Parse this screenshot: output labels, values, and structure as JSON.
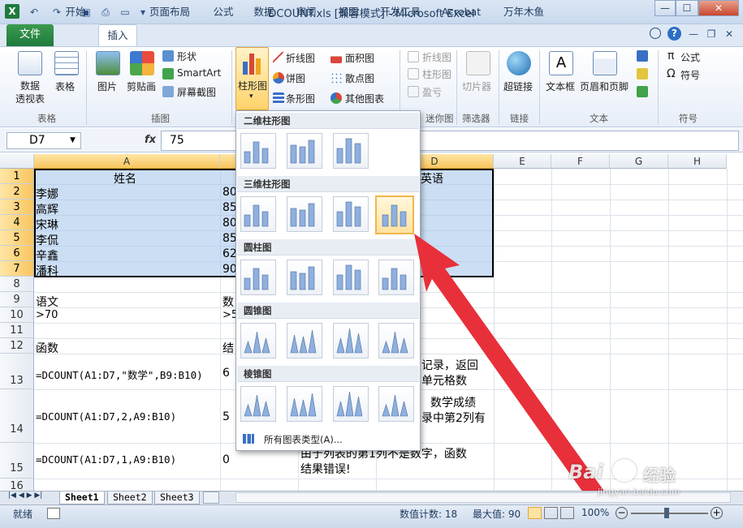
{
  "window": {
    "title": "DCOUNT.xls  [兼容模式] - Microsoft Excel",
    "app_icon": "X"
  },
  "tabs": [
    "文件",
    "开始",
    "插入",
    "页面布局",
    "公式",
    "数据",
    "审阅",
    "视图",
    "开发工具",
    "Acrobat",
    "万年木鱼"
  ],
  "ribbon": {
    "pivot_label": "数据\n透视表",
    "table_label": "表格",
    "picture_label": "图片",
    "clipart_label": "剪贴画",
    "shapes_label": "形状",
    "smartart_label": "SmartArt",
    "screenshot_label": "屏幕截图",
    "column_chart_label": "柱形图",
    "line_chart_label": "折线图",
    "pie_chart_label": "饼图",
    "bar_chart_label": "条形图",
    "area_chart_label": "面积图",
    "scatter_chart_label": "散点图",
    "other_chart_label": "其他图表",
    "spark_line_label": "折线图",
    "spark_column_label": "柱形图",
    "spark_winloss_label": "盈亏",
    "slicer_label": "切片器",
    "hyperlink_label": "超链接",
    "textbox_label": "文本框",
    "headerfooter_label": "页眉和页脚",
    "formula_label": "公式",
    "symbol_label": "符号",
    "groups": {
      "tables": "表格",
      "illustrations": "插图",
      "sparklines": "迷你图",
      "filter": "筛选器",
      "links": "链接",
      "text": "文本",
      "symbols": "符号"
    }
  },
  "formula_bar": {
    "name_box": "D7",
    "fx": "fx",
    "value": "75"
  },
  "columns": [
    "A",
    "B",
    "C",
    "D",
    "E",
    "F",
    "G",
    "H"
  ],
  "rows": [
    "1",
    "2",
    "3",
    "4",
    "5",
    "6",
    "7",
    "8",
    "9",
    "10",
    "11",
    "12",
    "13",
    "14",
    "15",
    "16"
  ],
  "cells": {
    "a1": "姓名",
    "d1": "英语",
    "a2": "李娜",
    "b2": "80",
    "a3": "高辉",
    "b3": "85",
    "a4": "宋琳",
    "b4": "80",
    "a5": "李侃",
    "b5": "85",
    "a6": "辛鑫",
    "b6": "62",
    "a7": "潘科",
    "b7": "90",
    "a9": "语文",
    "b9": "数",
    "a10": ">70",
    "b10": ">5",
    "a12": "函数",
    "b12": "结",
    "a13": "=DCOUNT(A1:D7,\"数学\",B9:B10)",
    "b13": "6",
    "c13a": "记录，返回",
    "c13b": "单元格数",
    "a14": "=DCOUNT(A1:D7,2,A9:B10)",
    "b14": "5",
    "c14a": "数学成绩",
    "c14b": "录中第2列有",
    "a15": "=DCOUNT(A1:D7,1,A9:B10)",
    "b15": "0",
    "c15a": "由于列表的第1列不是数字，函数",
    "c15b": "结果错误!"
  },
  "dropdown": {
    "section_2d": "二维柱形图",
    "section_3d": "三维柱形图",
    "section_cylinder": "圆柱图",
    "section_cone": "圆锥图",
    "section_pyramid": "棱锥图",
    "all_types": "所有图表类型(A)..."
  },
  "sheets": [
    "Sheet1",
    "Sheet2",
    "Sheet3"
  ],
  "status": {
    "ready": "就绪",
    "count": "数值计数: 18",
    "max": "最大值: 90",
    "zoom": "100%"
  },
  "watermark": {
    "brand": "Bai",
    "brand2": "经验",
    "url": "jingyan.baidu.com"
  },
  "colors": {
    "excel_green": "#1f7a3c",
    "selection": "#a0c3eb",
    "highlight": "#f2b64b",
    "arrow": "#e8303a"
  }
}
